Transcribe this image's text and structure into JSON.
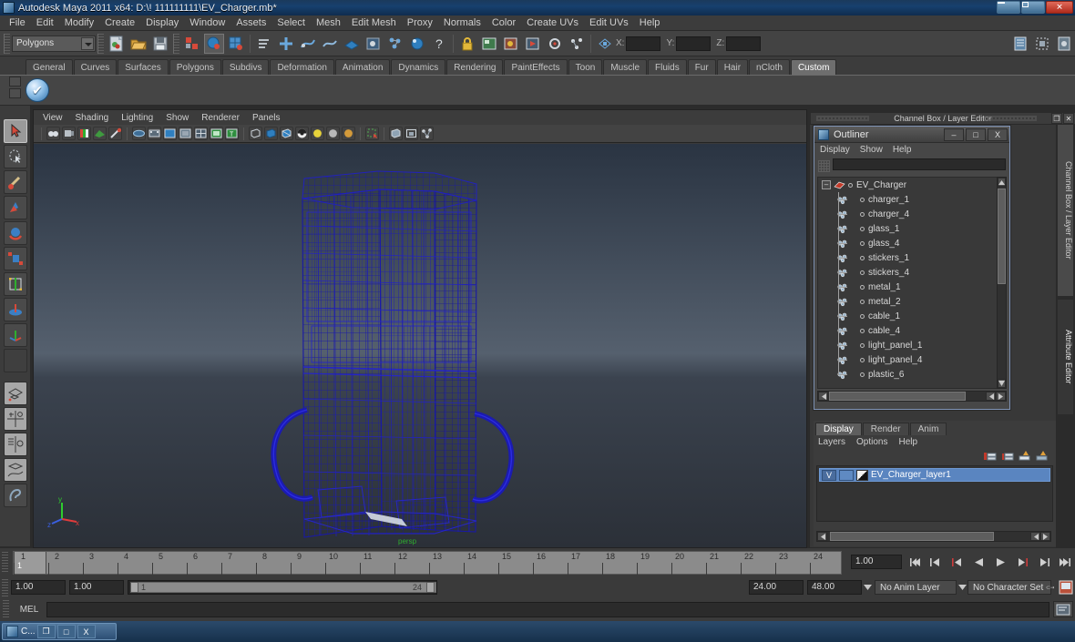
{
  "window": {
    "title": "Autodesk Maya 2011 x64: D:\\! 111111111\\EV_Charger.mb*",
    "app_icon": "maya-icon",
    "minimize": "–",
    "maximize": "□",
    "close": "✕"
  },
  "menubar": {
    "items": [
      "File",
      "Edit",
      "Modify",
      "Create",
      "Display",
      "Window",
      "Assets",
      "Select",
      "Mesh",
      "Edit Mesh",
      "Proxy",
      "Normals",
      "Color",
      "Create UVs",
      "Edit UVs",
      "Help"
    ]
  },
  "toolline": {
    "mode_selector": "Polygons",
    "x_label": "X:",
    "y_label": "Y:",
    "z_label": "Z:",
    "x_value": "",
    "y_value": "",
    "z_value": ""
  },
  "shelf": {
    "tabs": [
      "General",
      "Curves",
      "Surfaces",
      "Polygons",
      "Subdivs",
      "Deformation",
      "Animation",
      "Dynamics",
      "Rendering",
      "PaintEffects",
      "Toon",
      "Muscle",
      "Fluids",
      "Fur",
      "Hair",
      "nCloth",
      "Custom"
    ],
    "active_tab": "Custom",
    "items": [
      "check-shelf-button"
    ]
  },
  "toolbox": {
    "tools": [
      {
        "name": "select-tool",
        "selected": true
      },
      {
        "name": "lasso-select-tool",
        "selected": false
      },
      {
        "name": "paint-select-tool",
        "selected": false
      },
      {
        "name": "move-tool",
        "selected": false
      },
      {
        "name": "rotate-tool",
        "selected": false
      },
      {
        "name": "scale-tool",
        "selected": false
      },
      {
        "name": "universal-manipulator-tool",
        "selected": false
      },
      {
        "name": "soft-modification-tool",
        "selected": false
      },
      {
        "name": "show-manipulator-tool",
        "selected": false
      },
      {
        "name": "last-tool-used",
        "selected": false
      },
      {
        "name": "single-perspective-layout",
        "selected": false
      },
      {
        "name": "four-view-layout",
        "selected": false
      },
      {
        "name": "persp-outliner-layout",
        "selected": false
      },
      {
        "name": "persp-graph-layout",
        "selected": false
      },
      {
        "name": "hotbox-layout",
        "selected": false
      }
    ]
  },
  "viewport": {
    "menus": [
      "View",
      "Shading",
      "Lighting",
      "Show",
      "Renderer",
      "Panels"
    ],
    "camera_label": "persp",
    "axis": {
      "x": "x",
      "y": "y",
      "z": "z"
    },
    "wireframe_color": "#1919a5",
    "background_top": "#2a3442",
    "background_mid": "#55606e",
    "background_bottom": "#2b3038",
    "model_name": "EV_Charger wireframe"
  },
  "right_dock": {
    "header_label": "Channel Box / Layer Editor",
    "vertical_tabs": [
      "Channel Box / Layer Editor",
      "Attribute Editor"
    ],
    "active_vertical_tab": "Attribute Editor"
  },
  "outliner": {
    "title": "Outliner",
    "minimize": "–",
    "maximize": "□",
    "close": "X",
    "menus": [
      "Display",
      "Show",
      "Help"
    ],
    "search_value": "",
    "root": {
      "label": "EV_Charger",
      "expanded": true,
      "expand_glyph": "–"
    },
    "items": [
      {
        "label": "charger_1"
      },
      {
        "label": "charger_4"
      },
      {
        "label": "glass_1"
      },
      {
        "label": "glass_4"
      },
      {
        "label": "stickers_1"
      },
      {
        "label": "stickers_4"
      },
      {
        "label": "metal_1"
      },
      {
        "label": "metal_2"
      },
      {
        "label": "cable_1"
      },
      {
        "label": "cable_4"
      },
      {
        "label": "light_panel_1"
      },
      {
        "label": "light_panel_4"
      },
      {
        "label": "plastic_6"
      }
    ]
  },
  "layer_editor": {
    "tabs": [
      "Display",
      "Render",
      "Anim"
    ],
    "active_tab": "Display",
    "menus": [
      "Layers",
      "Options",
      "Help"
    ],
    "icons": [
      "new-layer-icon",
      "new-layer-from-selected-icon",
      "layer-up-icon",
      "layer-down-icon"
    ],
    "layers": [
      {
        "visibility": "V",
        "type": "",
        "name": "EV_Charger_layer1",
        "selected": true,
        "color": "#5a85c0"
      }
    ]
  },
  "timeline": {
    "ticks": [
      "1",
      "2",
      "3",
      "4",
      "5",
      "6",
      "7",
      "8",
      "9",
      "10",
      "11",
      "12",
      "13",
      "14",
      "15",
      "16",
      "17",
      "18",
      "19",
      "20",
      "21",
      "22",
      "23",
      "24"
    ],
    "current_frame": "1",
    "current_time_field": "1.00",
    "playback_buttons": [
      "go-to-start",
      "step-back-key",
      "step-back-frame",
      "play-backwards",
      "play-forwards",
      "step-forward-frame",
      "step-forward-key",
      "go-to-end"
    ]
  },
  "range_slider": {
    "anim_start": "1.00",
    "range_start": "1.00",
    "slider_start_label": "1",
    "slider_end_label": "24",
    "range_end": "24.00",
    "anim_end": "48.00",
    "anim_layer": "No Anim Layer",
    "character_set": "No Character Set"
  },
  "command_line": {
    "label": "MEL",
    "input_value": ""
  },
  "taskbar": {
    "item_label": "C...",
    "buttons": [
      "restore",
      "maximize",
      "close"
    ],
    "button_glyphs": [
      "❐",
      "□",
      "X"
    ]
  }
}
